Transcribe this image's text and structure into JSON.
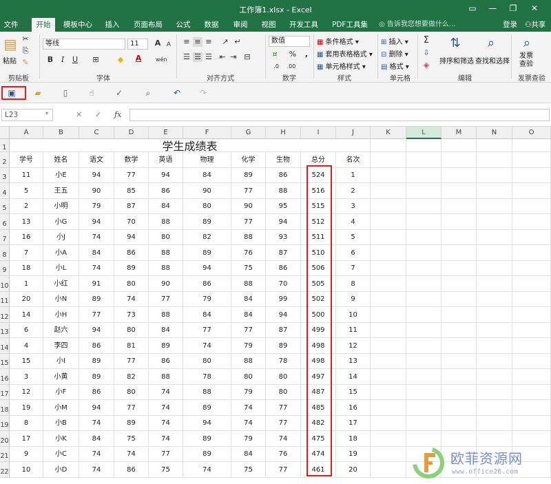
{
  "window": {
    "title": "工作簿1.xlsx - Excel",
    "controls": [
      "▭",
      "—",
      "❐",
      "✕"
    ]
  },
  "tabs": [
    "文件",
    "开始",
    "模板中心",
    "插入",
    "页面布局",
    "公式",
    "数据",
    "审阅",
    "视图",
    "开发工具",
    "PDF工具集"
  ],
  "active_tab": "开始",
  "tell_me": "告诉我您想要做什么...",
  "account": {
    "login": "登录",
    "share": "共享"
  },
  "ribbon": {
    "clipboard": {
      "paste": "粘贴",
      "label": "剪贴板"
    },
    "font": {
      "family": "等线",
      "size": "11",
      "bold": "B",
      "italic": "I",
      "underline": "U",
      "grow": "A",
      "shrink": "A",
      "color_letter": "A",
      "phonetic": "wén",
      "label": "字体"
    },
    "alignment": {
      "label": "对齐方式"
    },
    "number": {
      "format": "数值",
      "percent": "%",
      "comma": ",",
      "label": "数字"
    },
    "styles": {
      "conditional": "条件格式",
      "table": "套用表格格式",
      "cell": "单元格样式",
      "label": "样式"
    },
    "cells": {
      "insert": "插入",
      "delete": "删除",
      "format": "格式",
      "label": "单元格"
    },
    "editing": {
      "sort": "排序和筛选",
      "find": "查找和选择",
      "label": "编辑"
    },
    "invoice": {
      "check": "发票\n查验",
      "label": "发票查验"
    }
  },
  "formula_bar": {
    "name_box": "L23",
    "cancel": "✕",
    "enter": "✓",
    "fx": "fx",
    "value": ""
  },
  "columns": [
    "A",
    "B",
    "C",
    "D",
    "E",
    "F",
    "G",
    "H",
    "I",
    "J",
    "K",
    "L",
    "M",
    "N",
    "O"
  ],
  "selected_column": "L",
  "rows": [
    "1",
    "2",
    "3",
    "4",
    "5",
    "6",
    "7",
    "8",
    "9",
    "10",
    "11",
    "12",
    "13",
    "14",
    "15",
    "16",
    "17",
    "18",
    "19",
    "20",
    "21",
    "22"
  ],
  "sheet": {
    "title": "学生成绩表",
    "headers": [
      "学号",
      "姓名",
      "语文",
      "数学",
      "英语",
      "物理",
      "化学",
      "生物",
      "总分",
      "名次"
    ],
    "records": [
      [
        "11",
        "小E",
        "94",
        "77",
        "94",
        "84",
        "89",
        "86",
        "524",
        "1"
      ],
      [
        "5",
        "王五",
        "90",
        "85",
        "86",
        "90",
        "77",
        "88",
        "516",
        "2"
      ],
      [
        "2",
        "小明",
        "79",
        "87",
        "84",
        "80",
        "90",
        "95",
        "515",
        "3"
      ],
      [
        "13",
        "小G",
        "94",
        "70",
        "88",
        "89",
        "77",
        "94",
        "512",
        "4"
      ],
      [
        "16",
        "小J",
        "74",
        "94",
        "80",
        "82",
        "88",
        "93",
        "511",
        "5"
      ],
      [
        "7",
        "小A",
        "84",
        "86",
        "88",
        "89",
        "76",
        "87",
        "510",
        "6"
      ],
      [
        "18",
        "小L",
        "74",
        "89",
        "88",
        "94",
        "75",
        "86",
        "506",
        "7"
      ],
      [
        "1",
        "小红",
        "91",
        "80",
        "90",
        "86",
        "88",
        "70",
        "505",
        "8"
      ],
      [
        "20",
        "小N",
        "89",
        "74",
        "77",
        "79",
        "84",
        "99",
        "502",
        "9"
      ],
      [
        "14",
        "小H",
        "77",
        "73",
        "88",
        "84",
        "84",
        "94",
        "500",
        "10"
      ],
      [
        "6",
        "赵六",
        "94",
        "80",
        "84",
        "77",
        "77",
        "87",
        "499",
        "11"
      ],
      [
        "4",
        "李四",
        "86",
        "81",
        "89",
        "74",
        "79",
        "89",
        "498",
        "12"
      ],
      [
        "15",
        "小I",
        "89",
        "77",
        "86",
        "80",
        "88",
        "78",
        "498",
        "13"
      ],
      [
        "3",
        "小黄",
        "89",
        "82",
        "88",
        "78",
        "80",
        "80",
        "497",
        "14"
      ],
      [
        "12",
        "小F",
        "86",
        "80",
        "74",
        "88",
        "79",
        "80",
        "487",
        "15"
      ],
      [
        "19",
        "小M",
        "94",
        "77",
        "74",
        "89",
        "74",
        "77",
        "485",
        "16"
      ],
      [
        "8",
        "小B",
        "74",
        "89",
        "74",
        "94",
        "74",
        "77",
        "482",
        "17"
      ],
      [
        "17",
        "小K",
        "84",
        "75",
        "74",
        "89",
        "79",
        "74",
        "475",
        "18"
      ],
      [
        "9",
        "小C",
        "74",
        "74",
        "77",
        "89",
        "84",
        "76",
        "474",
        "19"
      ],
      [
        "10",
        "小D",
        "74",
        "86",
        "75",
        "74",
        "75",
        "77",
        "461",
        "20"
      ]
    ]
  },
  "watermark": {
    "text": "欧菲资源网",
    "url": "www.office26.com"
  },
  "colors": {
    "excel_green": "#217346",
    "highlight_red": "#d42020",
    "watermark_blue": "#7b8cc9"
  }
}
